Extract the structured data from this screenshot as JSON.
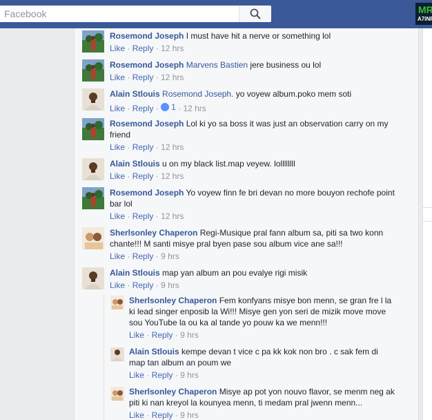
{
  "header": {
    "search_placeholder": "Facebook",
    "logo_line1": "MR",
    "logo_line2": "A7INF"
  },
  "actions": {
    "like": "Like",
    "reply": "Reply",
    "sep": "·"
  },
  "comments": [
    {
      "name": "Rosemond Joseph",
      "tag": "",
      "text": "I must have hit a nerve or something lol",
      "time": "12 hrs",
      "likes": ""
    },
    {
      "name": "Rosemond Joseph",
      "tag": "Marvens Bastien",
      "text": "jere business ou lol",
      "time": "12 hrs",
      "likes": ""
    },
    {
      "name": "Alain Stlouis",
      "tag": "Rosemond Joseph.",
      "text": "yo voyew album.poko mem soti",
      "time": "12 hrs",
      "likes": "1"
    },
    {
      "name": "Rosemond Joseph",
      "tag": "",
      "text": "Lol ki yo sa boss it was just an observation carry on my friend",
      "time": "12 hrs",
      "likes": ""
    },
    {
      "name": "Alain Stlouis",
      "tag": "",
      "text": "u on my black list.map veyew. lollllllll",
      "time": "12 hrs",
      "likes": ""
    },
    {
      "name": "Rosemond Joseph",
      "tag": "",
      "text": "Yo voyew finn fe bri devan no more bouyon rechofe point bar lol",
      "time": "12 hrs",
      "likes": ""
    },
    {
      "name": "Sherlsonley Chaperon",
      "tag": "",
      "text": "Regi-Musique pral fann album sa, piti sa two konn chante!!! M santi misye pral byen pase sou album vice ane sa!!!",
      "time": "9 hrs",
      "likes": ""
    },
    {
      "name": "Alain Stlouis",
      "tag": "",
      "text": "map yan album an pou evalye rigi misik",
      "time": "9 hrs",
      "likes": ""
    }
  ],
  "replies": [
    {
      "name": "Sherlsonley Chaperon",
      "text": "Fem konfyans misye bon menn, se gran fre l la ki lead singer enposib la Wi!!! Misye gen yon seri de mizik move move sou YouTube la ou ka al tande yo pouw ka we menn!!!",
      "time": "9 hrs"
    },
    {
      "name": "Alain Stlouis",
      "text": "kempe devan t vice c pa kk kok non bro . c sak fem di map tan album an poum we",
      "time": "9 hrs"
    },
    {
      "name": "Sherlsonley Chaperon",
      "text": "Misye ap pot yon nouvo flavor, se menm neg ak piti ki nan kreyol la kounyea menn, ti medam pral jwenn menn...",
      "time": "9 hrs"
    }
  ]
}
